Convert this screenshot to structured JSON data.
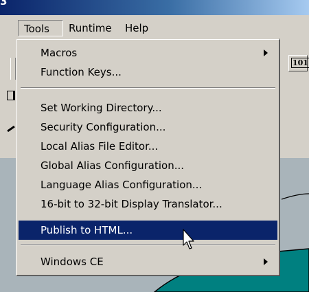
{
  "window": {
    "title_fragment": "3"
  },
  "menubar": {
    "items": [
      "Tools",
      "Runtime",
      "Help"
    ]
  },
  "toolbar": {
    "button_101_label": "101"
  },
  "tools_menu": {
    "items": [
      {
        "label": "Macros",
        "has_submenu": true
      },
      {
        "label": "Function Keys..."
      },
      {
        "label": "Set Working Directory..."
      },
      {
        "label": "Security Configuration..."
      },
      {
        "label": "Local Alias File Editor..."
      },
      {
        "label": "Global Alias Configuration..."
      },
      {
        "label": "Language Alias Configuration..."
      },
      {
        "label": "16-bit to 32-bit Display Translator..."
      },
      {
        "label": "Publish to HTML...",
        "highlighted": true
      },
      {
        "label": "Windows CE",
        "has_submenu": true
      }
    ]
  },
  "colors": {
    "highlight": "#0a246a",
    "canvas_gray": "#a9b4ba",
    "canvas_teal": "#008080"
  },
  "icons": {
    "cursor": "arrow-pointer-icon",
    "submenu": "submenu-arrow-icon"
  }
}
